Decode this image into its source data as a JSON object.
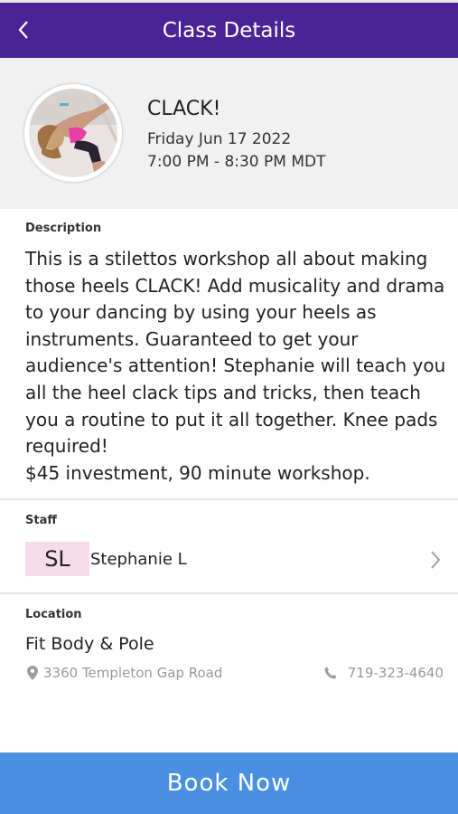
{
  "header": {
    "title": "Class Details",
    "back_icon": "chevron-left-icon",
    "background": "#4a2496"
  },
  "class": {
    "name": "CLACK!",
    "date": "Friday Jun 17 2022",
    "time": "7:00 PM - 8:30 PM MDT"
  },
  "description": {
    "label": "Description",
    "text": "This is a stilettos workshop all about making those heels CLACK! Add musicality and drama to your dancing by using your heels as instruments. Guaranteed to get your audience's attention! Stephanie will teach you all the heel clack tips and tricks, then teach you a routine to put it all together. Knee pads required!\n$45 investment, 90 minute workshop."
  },
  "staff": {
    "label": "Staff",
    "initials": "SL",
    "name": "Stephanie L",
    "initials_color": "#fadbea"
  },
  "location": {
    "label": "Location",
    "name": "Fit Body & Pole",
    "address": "3360 Templeton Gap Road",
    "phone": "719-323-4640",
    "address_icon": "map-marker-icon",
    "phone_icon": "phone-icon"
  },
  "footer": {
    "book_label": "Book Now",
    "button_color": "#4a90e2"
  }
}
